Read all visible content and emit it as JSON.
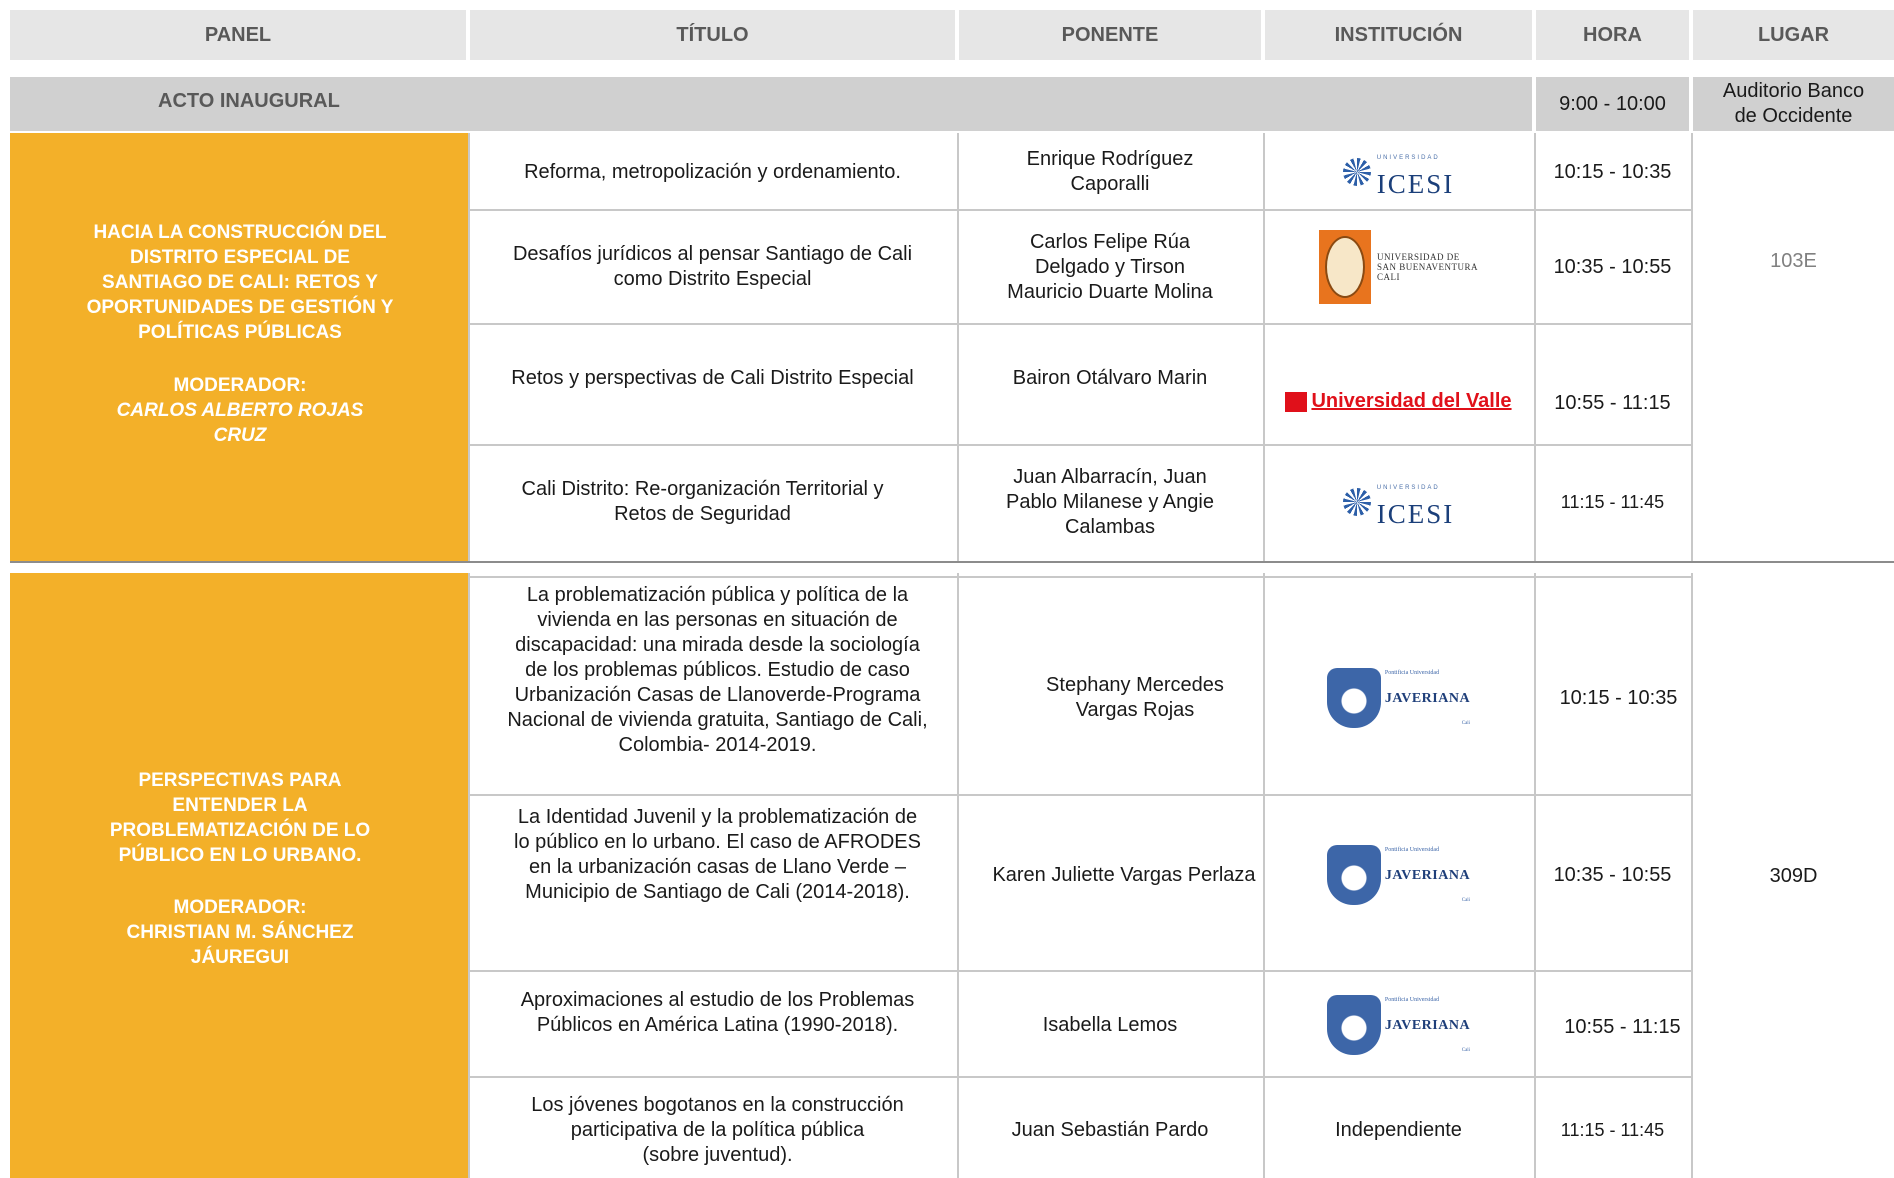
{
  "headers": {
    "panel": "PANEL",
    "titulo": "TÍTULO",
    "ponente": "PONENTE",
    "institucion": "INSTITUCIÓN",
    "hora": "HORA",
    "lugar": "LUGAR"
  },
  "acto": {
    "label": "ACTO INAUGURAL",
    "hora": "9:00 - 10:00",
    "lugar": "Auditorio Banco\nde Occidente"
  },
  "panel1": {
    "title": "HACIA LA CONSTRUCCIÓN DEL\nDISTRITO ESPECIAL DE\nSANTIAGO DE CALI: RETOS Y\nOPORTUNIDADES DE GESTIÓN Y\nPOLÍTICAS PÚBLICAS",
    "moderador_label": "MODERADOR:",
    "moderador_name": "CARLOS ALBERTO ROJAS\nCRUZ",
    "lugar": "103E",
    "rows": [
      {
        "titulo": "Reforma, metropolización y ordenamiento.",
        "ponente": "Enrique Rodríguez\nCaporalli",
        "hora": "10:15 - 10:35"
      },
      {
        "titulo": "Desafíos jurídicos al pensar Santiago de Cali\ncomo Distrito Especial",
        "ponente": "Carlos Felipe Rúa\nDelgado y Tirson\nMauricio Duarte Molina",
        "hora": "10:35 - 10:55"
      },
      {
        "titulo": "Retos y perspectivas de Cali Distrito Especial",
        "ponente": "Bairon Otálvaro Marin",
        "hora": "10:55 - 11:15"
      },
      {
        "titulo": "Cali Distrito: Re-organización Territorial y\nRetos de Seguridad",
        "ponente": "Juan Albarracín, Juan\nPablo Milanese y Angie\nCalambas",
        "hora": "11:15 - 11:45"
      }
    ]
  },
  "panel2": {
    "title": "PERSPECTIVAS PARA\nENTENDER LA\nPROBLEMATIZACIÓN DE LO\nPÚBLICO EN LO URBANO.",
    "moderador_label": "MODERADOR:",
    "moderador_name": "CHRISTIAN M. SÁNCHEZ\nJÁUREGUI",
    "lugar": "309D",
    "rows": [
      {
        "titulo": "La problematización pública y política de la\nvivienda en las personas en situación de\ndiscapacidad: una mirada desde la sociología\nde los problemas públicos. Estudio de caso\nUrbanización Casas de Llanoverde-Programa\nNacional de vivienda gratuita, Santiago de Cali,\nColombia- 2014-2019.",
        "ponente": "Stephany Mercedes\nVargas Rojas",
        "hora": "10:15 - 10:35"
      },
      {
        "titulo": "La Identidad Juvenil y la problematización de\nlo público en lo urbano. El caso de AFRODES\nen la urbanización casas de Llano Verde –\nMunicipio de Santiago de Cali (2014-2018).",
        "ponente": "Karen Juliette Vargas Perlaza",
        "hora": "10:35 - 10:55"
      },
      {
        "titulo": "Aproximaciones al estudio de los Problemas\nPúblicos en América Latina (1990-2018).",
        "ponente": "Isabella Lemos",
        "hora": "10:55 - 11:15"
      },
      {
        "titulo": "Los jóvenes bogotanos en la construcción\nparticipativa de la política pública\n(sobre juventud).",
        "ponente": "Juan Sebastián Pardo",
        "hora": "11:15 - 11:45",
        "institucion": "Independiente"
      }
    ]
  },
  "logos": {
    "icesi": {
      "small": "UNIVERSIDAD",
      "big": "ICESI",
      "icon": "icesi-logo-icon",
      "color": "#1b3f7a"
    },
    "usb": {
      "line1": "UNIVERSIDAD DE",
      "line2": "SAN BUENAVENTURA",
      "line3": "CALI",
      "icon": "usb-seal-icon",
      "color": "#e8741e"
    },
    "valle": {
      "text": "Universidad del Valle",
      "icon": "univalle-logo-icon",
      "color": "#e0101a"
    },
    "javeriana": {
      "sub": "Pontificia Universidad",
      "big": "JAVERIANA",
      "tiny": "Cali",
      "icon": "javeriana-shield-icon",
      "color": "#1f3f7a"
    }
  },
  "colors": {
    "orange": "#f3b029",
    "header_grey": "#e6e6e6",
    "acto_grey": "#d0d0d0"
  }
}
